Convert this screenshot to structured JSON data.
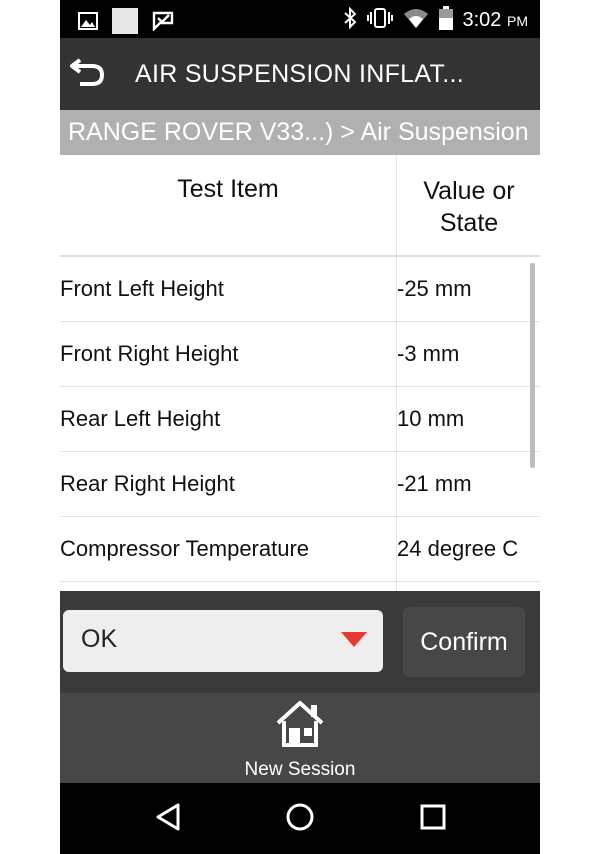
{
  "status_bar": {
    "time": "3:02",
    "ampm": "PM",
    "icons": [
      "image-icon",
      "square-icon",
      "check-flag-icon",
      "bluetooth-icon",
      "vibrate-icon",
      "wifi-icon",
      "battery-icon"
    ]
  },
  "app_bar": {
    "title": "AIR SUSPENSION INFLAT...",
    "back_icon": "back-arrow-icon"
  },
  "breadcrumb": "RANGE ROVER V33...) > Air Suspension",
  "table": {
    "headers": {
      "item": "Test Item",
      "value": "Value or State"
    },
    "rows": [
      {
        "name": "Front Left Height",
        "value": "-25 mm"
      },
      {
        "name": "Front Right Height",
        "value": "-3 mm"
      },
      {
        "name": "Rear Left Height",
        "value": "10 mm"
      },
      {
        "name": "Rear Right Height",
        "value": "-21 mm"
      },
      {
        "name": "Compressor Temperature",
        "value": "24 degree C"
      },
      {
        "name": "",
        "value": ""
      }
    ]
  },
  "action": {
    "select_value": "OK",
    "confirm_label": "Confirm"
  },
  "bottom": {
    "home_label": "New Session",
    "home_icon": "house-icon"
  },
  "colors": {
    "status_bar": "#000000",
    "app_bar": "#333333",
    "breadcrumb": "#b0b0b0",
    "dropdown_caret": "#e53935",
    "action_bar": "#3a3a3a",
    "bottom_bar": "#474747"
  }
}
